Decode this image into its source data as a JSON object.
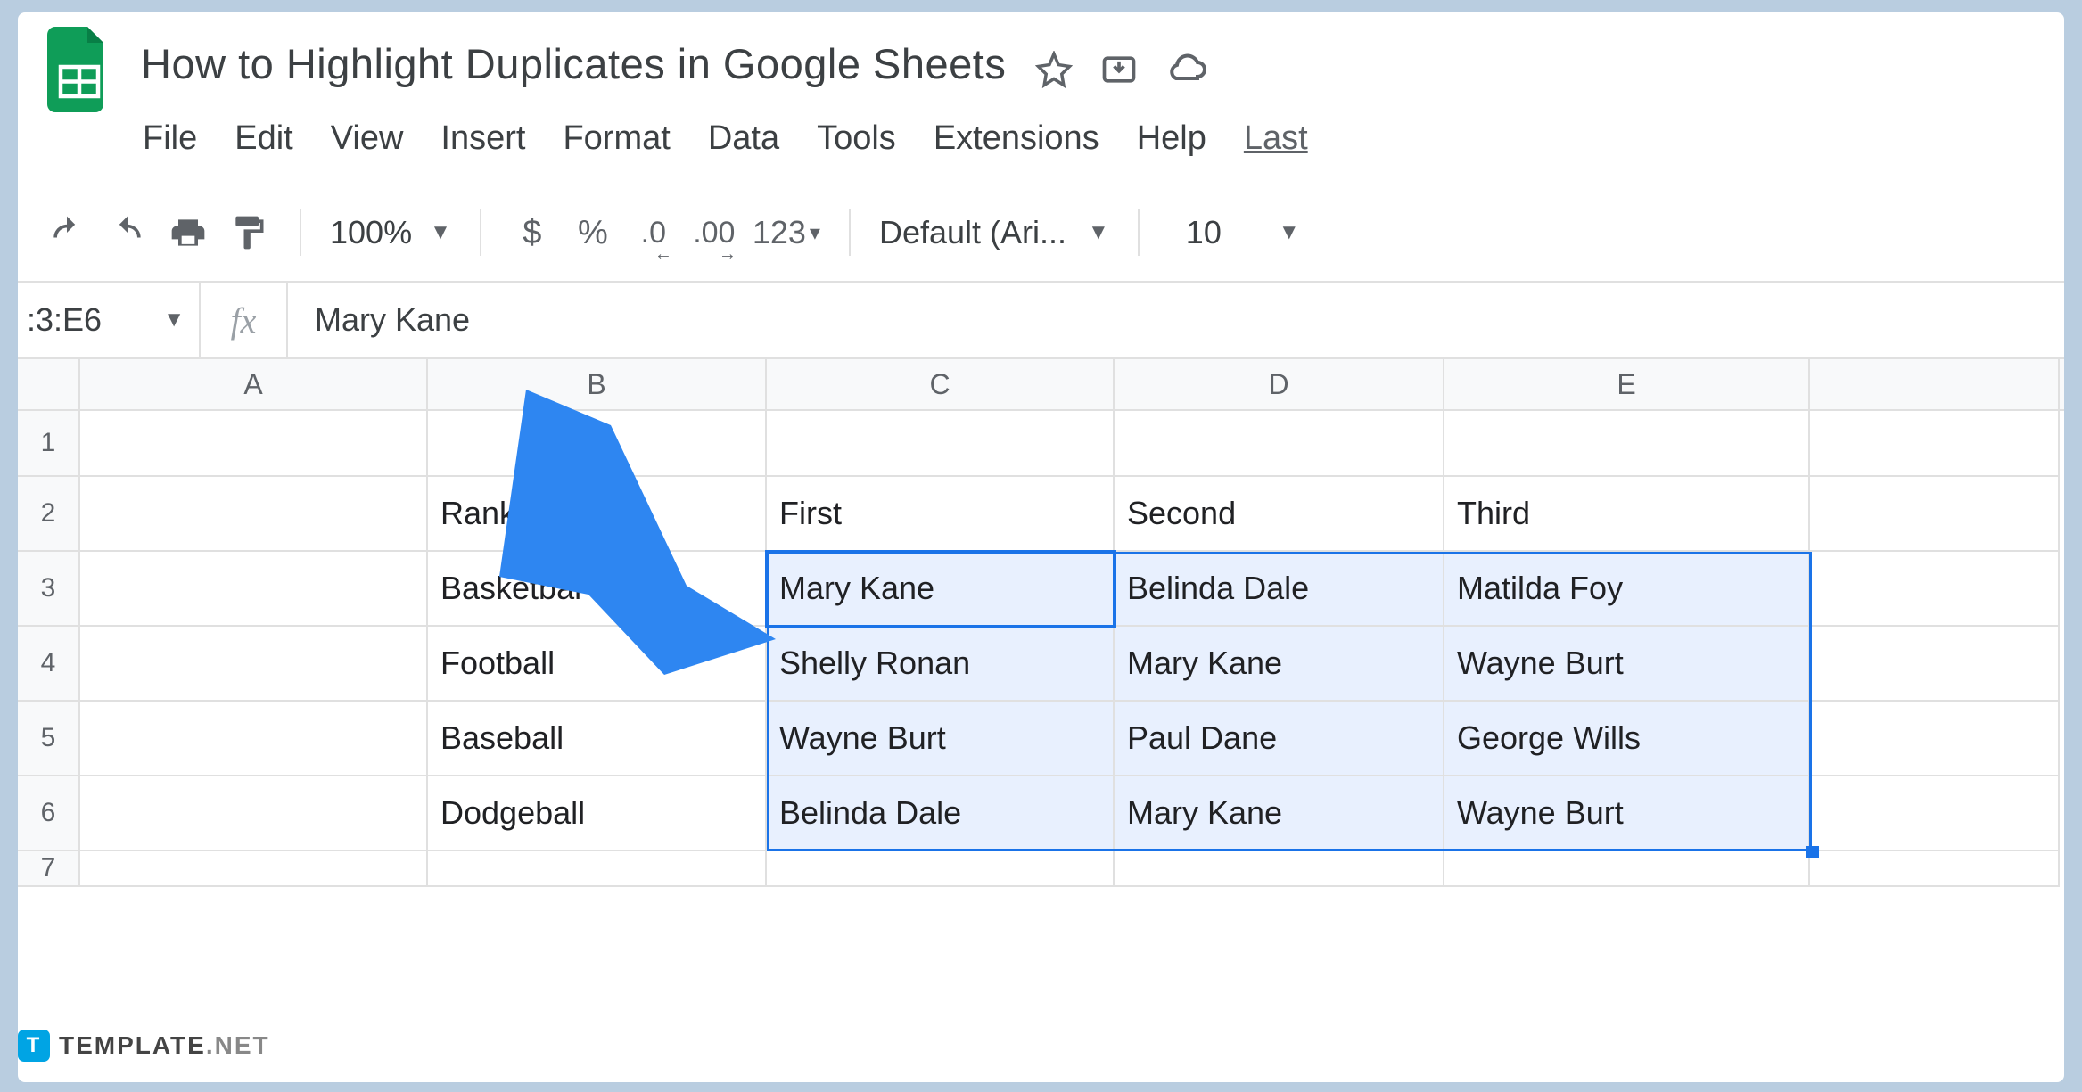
{
  "doc": {
    "title": "How to Highlight Duplicates in Google Sheets"
  },
  "menu": {
    "file": "File",
    "edit": "Edit",
    "view": "View",
    "insert": "Insert",
    "format": "Format",
    "data": "Data",
    "tools": "Tools",
    "extensions": "Extensions",
    "help": "Help",
    "last": "Last"
  },
  "toolbar": {
    "zoom": "100%",
    "currency": "$",
    "percent": "%",
    "dec_dec": ".0",
    "dec_inc": ".00",
    "numfmt": "123",
    "font": "Default (Ari...",
    "size": "10"
  },
  "formula": {
    "range": ":3:E6",
    "fx": "fx",
    "value": "Mary Kane"
  },
  "columns": [
    "A",
    "B",
    "C",
    "D",
    "E"
  ],
  "rows": [
    "1",
    "2",
    "3",
    "4",
    "5",
    "6",
    "7"
  ],
  "cells": {
    "B2": "Rankings",
    "C2": "First",
    "D2": "Second",
    "E2": "Third",
    "B3": "Basketbal",
    "C3": "Mary Kane",
    "D3": "Belinda Dale",
    "E3": "Matilda Foy",
    "B4": "Football",
    "C4": "Shelly Ronan",
    "D4": "Mary Kane",
    "E4": "Wayne Burt",
    "B5": "Baseball",
    "C5": "Wayne Burt",
    "D5": "Paul Dane",
    "E5": "George Wills",
    "B6": "Dodgeball",
    "C6": "Belinda Dale",
    "D6": "Mary Kane",
    "E6": "Wayne Burt"
  },
  "watermark": {
    "badge": "T",
    "text1": "TEMPLATE",
    "text2": ".NET"
  }
}
